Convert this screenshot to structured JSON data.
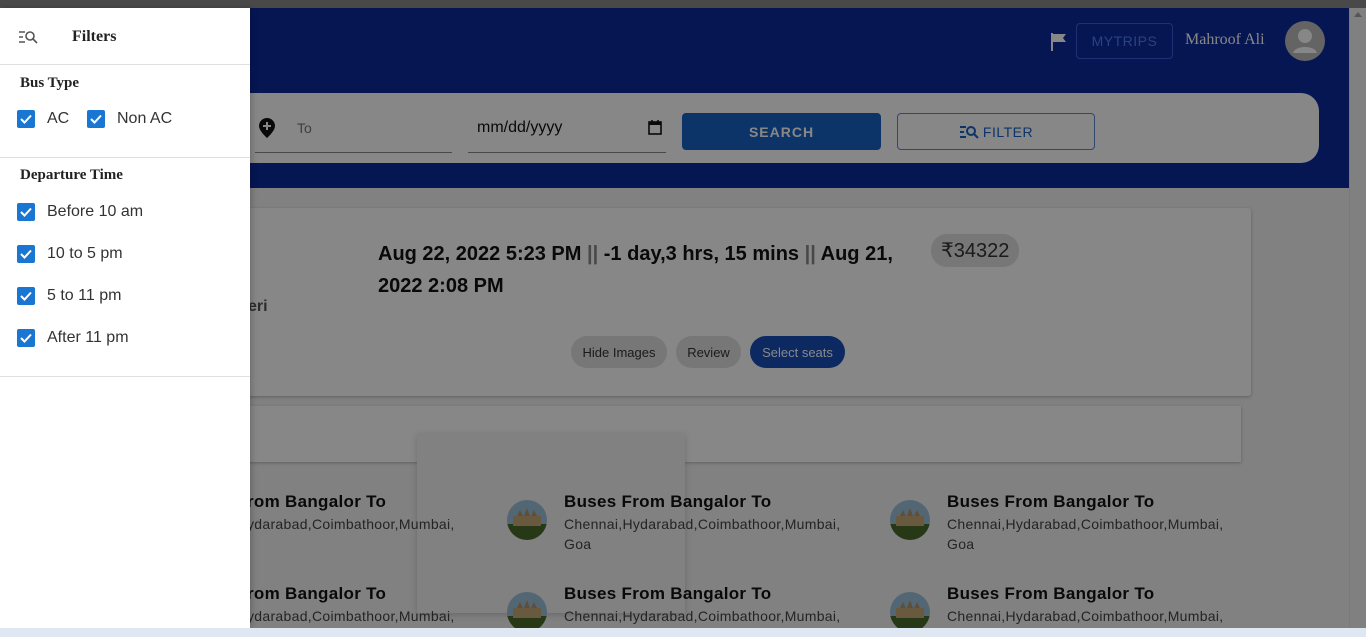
{
  "header": {
    "mytrips_label": "MYTRIPS",
    "user_name": "Mahroof Ali"
  },
  "search": {
    "to_placeholder": "To",
    "date_value": "mm/dd/yyyy",
    "search_label": "SEARCH",
    "filter_label": "FILTER"
  },
  "trip": {
    "depart": "Aug 22, 2022 5:23 PM",
    "duration": "-1 day,3 hrs, 15 mins",
    "arrive": "Aug 21, 2022 2:08 PM",
    "separator": "||",
    "price": "₹34322",
    "partial_text": "eri",
    "buttons": {
      "hide_images": "Hide Images",
      "review": "Review",
      "select_seats": "Select seats"
    }
  },
  "routes": [
    {
      "title": "Buses From Bangalor To",
      "cities": "Chennai,Hydarabad,Coimbathoor,Mumbai, Goa"
    },
    {
      "title": "Buses From Bangalor To",
      "cities": "Chennai,Hydarabad,Coimbathoor,Mumbai, Goa"
    },
    {
      "title": "Buses From Bangalor To",
      "cities": "Chennai,Hydarabad,Coimbathoor,Mumbai, Goa"
    },
    {
      "title": "Buses From Bangalor To",
      "cities": "Chennai,Hydarabad,Coimbathoor,Mumbai,"
    },
    {
      "title": "Buses From Bangalor To",
      "cities": "Chennai,Hydarabad,Coimbathoor,Mumbai,"
    },
    {
      "title": "Buses From Bangalor To",
      "cities": "Chennai,Hydarabad,Coimbathoor,Mumbai,"
    }
  ],
  "partial_routes": {
    "title": "rom Bangalor To",
    "cities": "ydarabad,Coimbathoor,Mumbai,"
  },
  "drawer": {
    "title": "Filters",
    "bus_type": {
      "title": "Bus Type",
      "options": [
        {
          "label": "AC",
          "checked": true
        },
        {
          "label": "Non AC",
          "checked": true
        }
      ]
    },
    "departure_time": {
      "title": "Departure Time",
      "options": [
        {
          "label": "Before 10 am",
          "checked": true
        },
        {
          "label": "10 to 5 pm",
          "checked": true
        },
        {
          "label": "5 to 11 pm",
          "checked": true
        },
        {
          "label": "After 11 pm",
          "checked": true
        }
      ]
    }
  },
  "colors": {
    "header_bg": "#0d2b9e",
    "primary": "#1a63c7",
    "checkbox": "#1976d2"
  }
}
